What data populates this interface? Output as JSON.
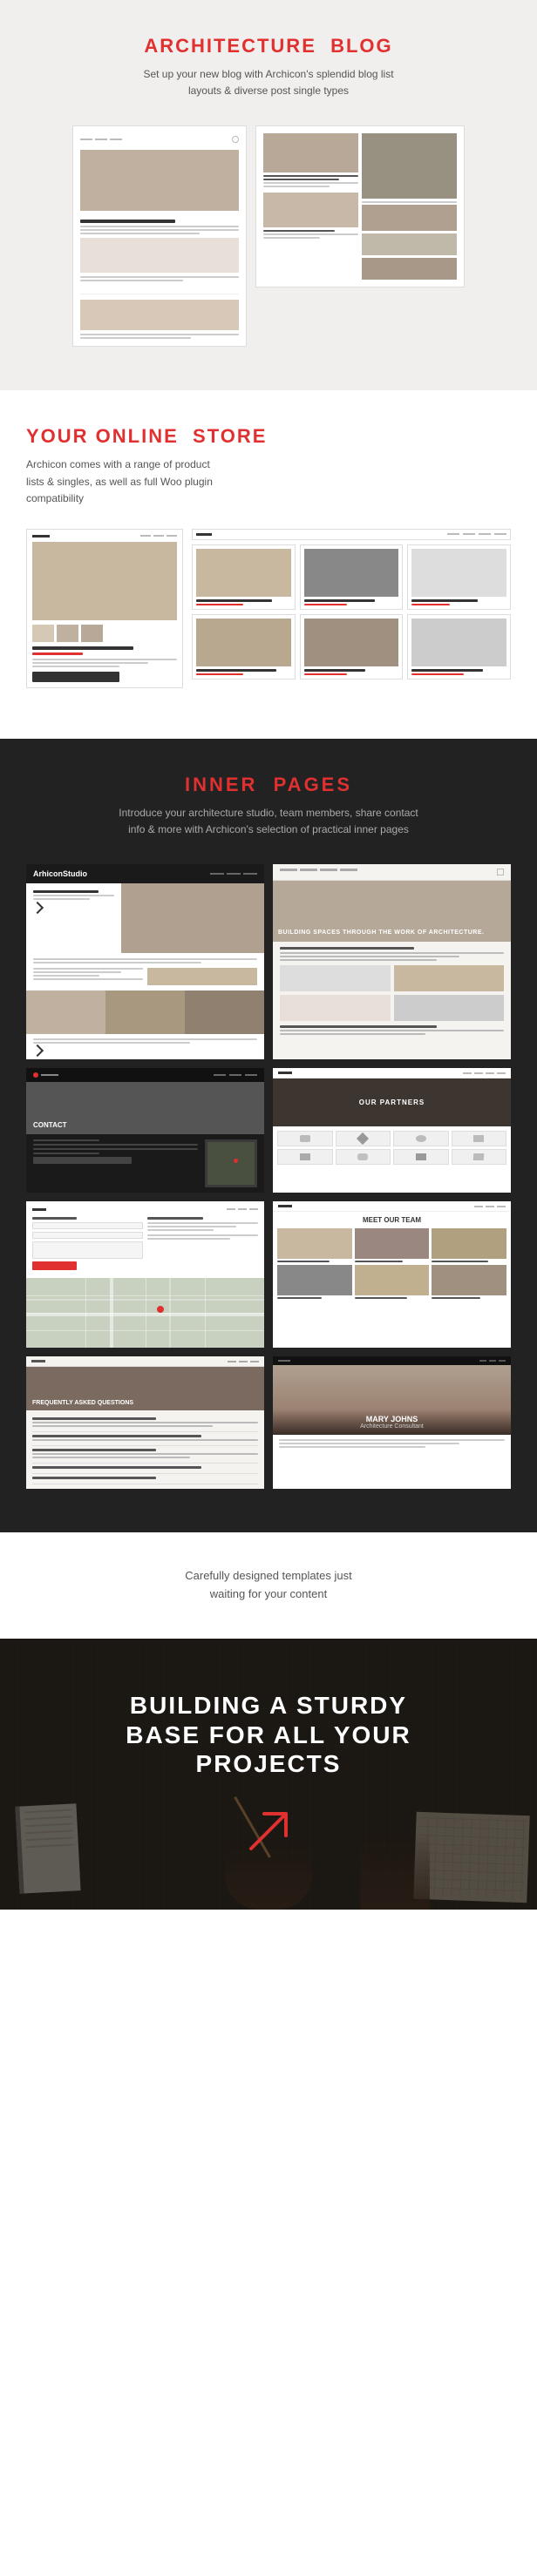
{
  "blog": {
    "title_main": "ARCHITECTURE",
    "title_accent": "BLOG",
    "description": "Set up your new blog with Archicon's splendid blog list layouts & diverse post single types"
  },
  "store": {
    "title_pre": "YOUR ONLINE",
    "title_accent": "STORE",
    "description": "Archicon comes with a range of product lists & singles, as well as full Woo plugin compatibility"
  },
  "inner": {
    "title_pre": "INNER",
    "title_accent": "PAGES",
    "description": "Introduce your architecture studio, team members, share contact info & more with Archicon's selection of practical inner pages",
    "studio_logo": "ArhiconStudio",
    "services_hero_text": "BUILDING SPACES THROUGH THE WORK OF ARCHITECTURE.",
    "partners_title": "OUR PARTNERS",
    "contact_label": "CONTACT",
    "team_header": "Meet our team",
    "faq_hero_text": "FREQUENTLY ASKED QUESTIONS",
    "profile_name": "MARY JOHNS",
    "profile_title": "Architecture Consultant"
  },
  "waiting": {
    "line1": "Carefully designed templates just",
    "line2": "waiting for your content"
  },
  "building": {
    "title_line1": "BUILDING A STURDY",
    "title_line2": "BASE FOR ALL YOUR",
    "title_line3": "PROJECTS"
  }
}
